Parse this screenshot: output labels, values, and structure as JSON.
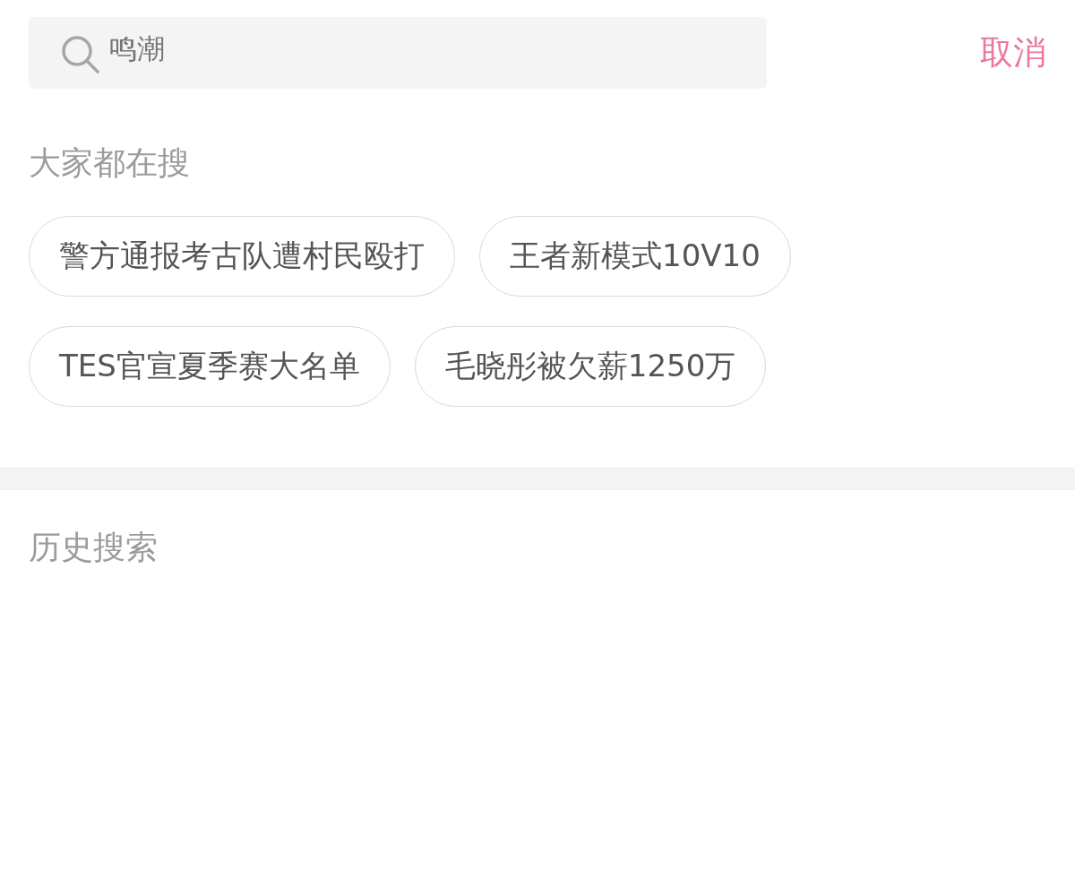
{
  "search": {
    "placeholder": "鸣潮"
  },
  "cancel_button": "取消",
  "trending": {
    "title": "大家都在搜",
    "chips": [
      "警方通报考古队遭村民殴打",
      "王者新模式10V10",
      "TES官宣夏季赛大名单",
      "毛晓彤被欠薪1250万"
    ]
  },
  "history": {
    "title": "历史搜索"
  }
}
